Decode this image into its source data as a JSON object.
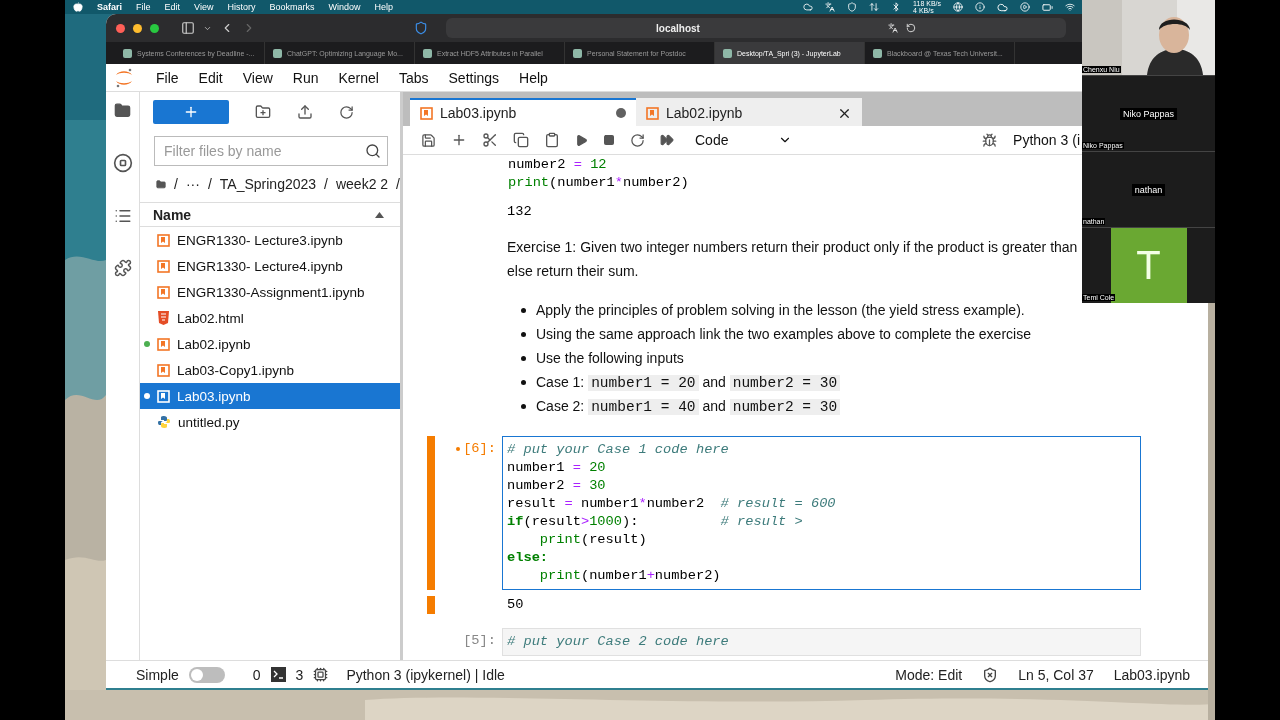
{
  "mac_menubar": {
    "app": "Safari",
    "menus": [
      "File",
      "Edit",
      "View",
      "History",
      "Bookmarks",
      "Window",
      "Help"
    ],
    "network": {
      "up": "118 KB/s",
      "down": "4 KB/s"
    }
  },
  "browser": {
    "address": "localhost",
    "tabs": [
      {
        "label": "Systems Conferences by Deadline -...",
        "selected": false
      },
      {
        "label": "ChatGPT: Optimizing Language Mo...",
        "selected": false
      },
      {
        "label": "Extract HDF5 Attributes in Parallel",
        "selected": false
      },
      {
        "label": "Personal Statement for Postdoc",
        "selected": false
      },
      {
        "label": "Desktop/TA_Spri (3) - JupyterLab",
        "selected": true
      },
      {
        "label": "Blackboard @ Texas Tech Universit...",
        "selected": false
      }
    ]
  },
  "jupyter": {
    "menus": [
      "File",
      "Edit",
      "View",
      "Run",
      "Kernel",
      "Tabs",
      "Settings",
      "Help"
    ],
    "file_browser": {
      "filter_placeholder": "Filter files by name",
      "breadcrumb": [
        "/",
        "···",
        "/",
        "TA_Spring2023",
        "/",
        "week2 2",
        "/"
      ],
      "column": "Name",
      "files": [
        {
          "name": "ENGR1330- Lecture3.ipynb",
          "kind": "notebook",
          "running": false,
          "selected": false
        },
        {
          "name": "ENGR1330- Lecture4.ipynb",
          "kind": "notebook",
          "running": false,
          "selected": false
        },
        {
          "name": "ENGR1330-Assignment1.ipynb",
          "kind": "notebook",
          "running": false,
          "selected": false
        },
        {
          "name": "Lab02.html",
          "kind": "html",
          "running": false,
          "selected": false
        },
        {
          "name": "Lab02.ipynb",
          "kind": "notebook",
          "running": true,
          "selected": false
        },
        {
          "name": "Lab03-Copy1.ipynb",
          "kind": "notebook",
          "running": false,
          "selected": false
        },
        {
          "name": "Lab03.ipynb",
          "kind": "notebook",
          "running": true,
          "selected": true
        },
        {
          "name": "untitled.py",
          "kind": "python",
          "running": false,
          "selected": false
        }
      ]
    },
    "notebook": {
      "tabs": [
        {
          "label": "Lab03.ipynb",
          "selected": true,
          "modified": true
        },
        {
          "label": "Lab02.ipynb",
          "selected": false,
          "modified": false
        }
      ],
      "cell_type": "Code",
      "kernel": "Python 3 (i",
      "cells": [
        {
          "kind": "code",
          "active": false,
          "lines": [
            {
              "indented": false,
              "tokens": [
                {
                  "kind": "name",
                  "text": "number2 "
                },
                {
                  "kind": "op",
                  "text": "="
                },
                {
                  "kind": "num",
                  "text": " 12"
                }
              ]
            },
            {
              "indented": false,
              "tokens": [
                {
                  "kind": "builtin",
                  "text": "print"
                },
                {
                  "kind": "name",
                  "text": "(number1"
                },
                {
                  "kind": "op",
                  "text": "*"
                },
                {
                  "kind": "name",
                  "text": "number2)"
                }
              ]
            }
          ],
          "output": "132"
        },
        {
          "kind": "markdown",
          "paragraph": [
            "Exercise 1: Given two integer numbers return their product only if the product is greater than",
            "else return their sum."
          ],
          "bullets": [
            [
              {
                "kind": "text",
                "text": "Apply the principles of problem solving in the lesson (the yield stress example)."
              }
            ],
            [
              {
                "kind": "text",
                "text": "Using the same approach link the two examples above to complete the exercise"
              }
            ],
            [
              {
                "kind": "text",
                "text": "Use the following inputs"
              }
            ],
            [
              {
                "kind": "text",
                "text": "Case 1: "
              },
              {
                "kind": "code",
                "text": "number1 = 20"
              },
              {
                "kind": "text",
                "text": " and "
              },
              {
                "kind": "code",
                "text": "number2 = 30"
              }
            ],
            [
              {
                "kind": "text",
                "text": "Case 2: "
              },
              {
                "kind": "code",
                "text": "number1 = 40"
              },
              {
                "kind": "text",
                "text": " and "
              },
              {
                "kind": "code",
                "text": "number2 = 30"
              }
            ]
          ]
        },
        {
          "kind": "code",
          "prompt": "[6]:",
          "dirty": true,
          "active": true,
          "lines": [
            {
              "indented": false,
              "tokens": [
                {
                  "kind": "comment",
                  "text": "# put your Case 1 code here"
                }
              ]
            },
            {
              "indented": false,
              "tokens": [
                {
                  "kind": "name",
                  "text": "number1 "
                },
                {
                  "kind": "op",
                  "text": "="
                },
                {
                  "kind": "num",
                  "text": " 20"
                }
              ]
            },
            {
              "indented": false,
              "tokens": [
                {
                  "kind": "name",
                  "text": "number2 "
                },
                {
                  "kind": "op",
                  "text": "="
                },
                {
                  "kind": "num",
                  "text": " 30"
                }
              ]
            },
            {
              "indented": false,
              "tokens": [
                {
                  "kind": "name",
                  "text": "result "
                },
                {
                  "kind": "op",
                  "text": "="
                },
                {
                  "kind": "name",
                  "text": " number1"
                },
                {
                  "kind": "op",
                  "text": "*"
                },
                {
                  "kind": "name",
                  "text": "number2  "
                },
                {
                  "kind": "comment",
                  "text": "# result = 600"
                }
              ]
            },
            {
              "indented": false,
              "tokens": [
                {
                  "kind": "kw",
                  "text": "if"
                },
                {
                  "kind": "name",
                  "text": "(result"
                },
                {
                  "kind": "op",
                  "text": ">"
                },
                {
                  "kind": "num",
                  "text": "1000"
                },
                {
                  "kind": "name",
                  "text": "):          "
                },
                {
                  "kind": "comment",
                  "text": "# result >"
                }
              ]
            },
            {
              "indented": true,
              "tokens": [
                {
                  "kind": "builtin",
                  "text": "print"
                },
                {
                  "kind": "name",
                  "text": "(result)"
                }
              ]
            },
            {
              "indented": false,
              "tokens": [
                {
                  "kind": "kw",
                  "text": "else:"
                }
              ]
            },
            {
              "indented": true,
              "tokens": [
                {
                  "kind": "builtin",
                  "text": "print"
                },
                {
                  "kind": "name",
                  "text": "(number1"
                },
                {
                  "kind": "op",
                  "text": "+"
                },
                {
                  "kind": "name",
                  "text": "number2)"
                }
              ]
            }
          ],
          "output": "50"
        },
        {
          "kind": "code",
          "prompt": "[5]:",
          "dirty": false,
          "active": false,
          "lines": [
            {
              "indented": false,
              "tokens": [
                {
                  "kind": "comment",
                  "text": "# put your Case 2 code here"
                }
              ]
            }
          ]
        }
      ]
    },
    "status_bar": {
      "simple_label": "Simple",
      "simple_mode": false,
      "terminals": "0",
      "kernels": "3",
      "kernel_status": "Python 3 (ipykernel) | Idle",
      "mode": "Mode: Edit",
      "position": "Ln 5, Col 37",
      "file": "Lab03.ipynb"
    }
  },
  "participants": [
    {
      "kind": "video",
      "name": "Chenxu Niu"
    },
    {
      "kind": "name",
      "name": "Niko Pappas",
      "display": "Niko Pappas"
    },
    {
      "kind": "name",
      "name": "nathan",
      "display": "nathan"
    },
    {
      "kind": "avatar",
      "name": "Temi Cole",
      "initial": "T"
    }
  ]
}
